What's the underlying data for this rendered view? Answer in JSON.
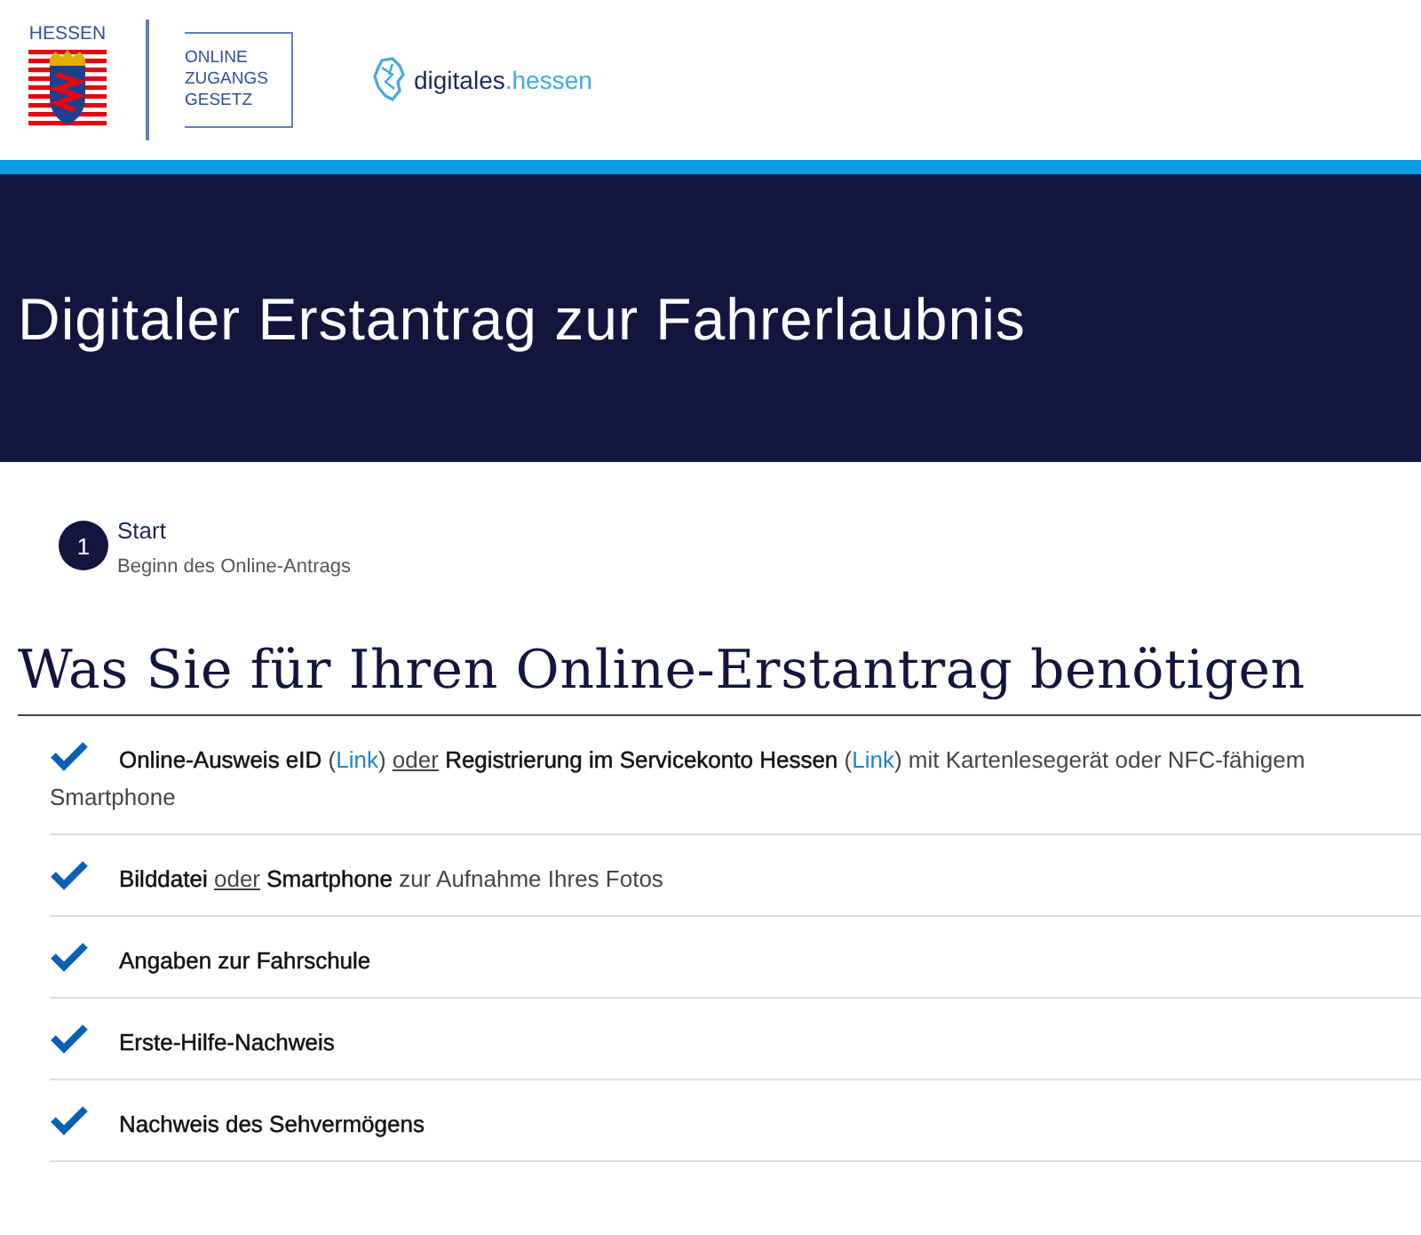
{
  "header": {
    "state_logo_text": "HESSEN",
    "ozg_logo_lines": [
      "ONLINE",
      "ZUGANGS",
      "GESETZ"
    ],
    "digital_logo": {
      "part_1": "digitales",
      "part_2": ".hessen"
    }
  },
  "banner": {
    "title": "Digitaler Erstantrag zur Fahrerlaubnis"
  },
  "steps": [
    {
      "number": "1",
      "title": "Start",
      "subtitle": "Beginn des Online-Antrags",
      "selected": true
    }
  ],
  "heading": "Was Sie für Ihren Online-Erstantrag benötigen",
  "requirements": [
    {
      "checked": true,
      "segments": [
        {
          "kind": "bold",
          "text": "Online-Ausweis eID"
        },
        {
          "kind": "plain",
          "text": " ("
        },
        {
          "kind": "link",
          "text": "Link"
        },
        {
          "kind": "plain",
          "text": ") "
        },
        {
          "kind": "underline",
          "text": "oder"
        },
        {
          "kind": "bold",
          "text": " Registrierung im Servicekonto Hessen"
        },
        {
          "kind": "plain",
          "text": " ("
        },
        {
          "kind": "link",
          "text": "Link"
        },
        {
          "kind": "plain",
          "text": ") mit Kartenlesegerät oder NFC-fähigem Smartphone"
        }
      ]
    },
    {
      "checked": true,
      "segments": [
        {
          "kind": "bold",
          "text": "Bilddatei "
        },
        {
          "kind": "underline",
          "text": "oder"
        },
        {
          "kind": "bold",
          "text": " Smartphone"
        },
        {
          "kind": "plain",
          "text": " zur Aufnahme Ihres Fotos"
        }
      ]
    },
    {
      "checked": true,
      "segments": [
        {
          "kind": "bold",
          "text": "Angaben zur Fahrschule"
        }
      ]
    },
    {
      "checked": true,
      "segments": [
        {
          "kind": "bold",
          "text": "Erste-Hilfe-Nachweis"
        }
      ]
    },
    {
      "checked": true,
      "segments": [
        {
          "kind": "bold",
          "text": "Nachweis des Sehvermögens"
        }
      ]
    }
  ]
}
